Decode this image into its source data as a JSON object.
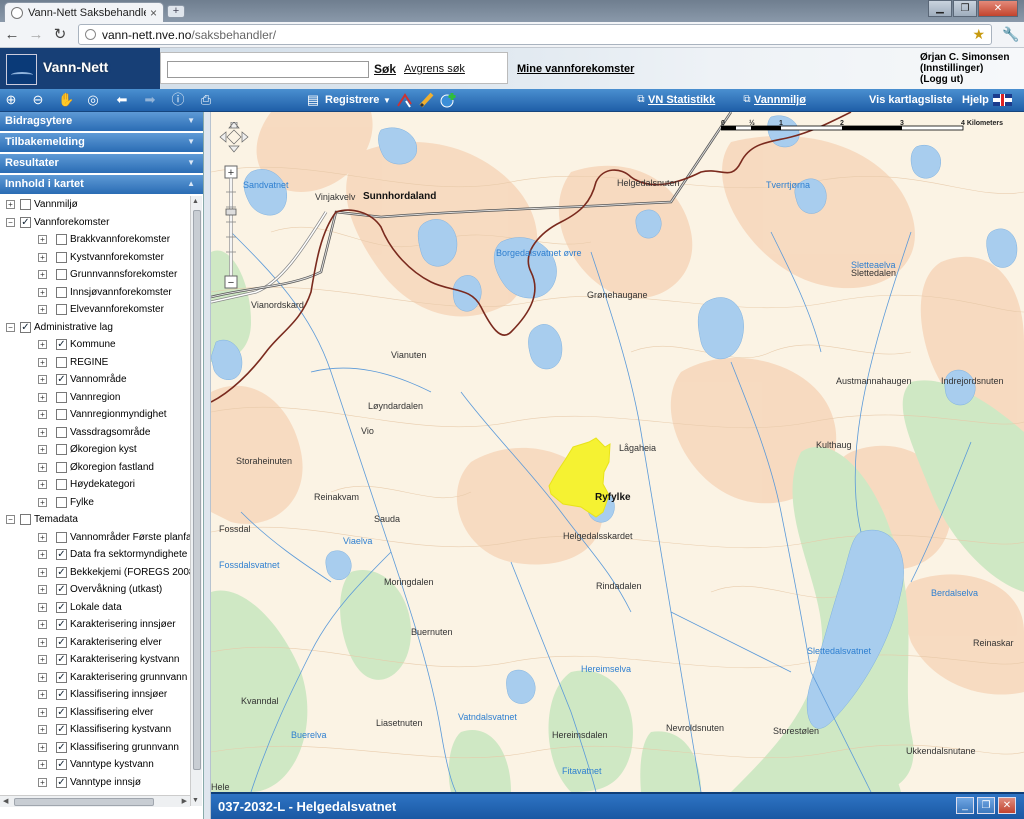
{
  "browser": {
    "tab_title": "Vann-Nett Saksbehandler",
    "tab_close": "×",
    "new_tab": "+",
    "url_host": "vann-nett.nve.no",
    "url_path": "/saksbehandler/",
    "window_buttons": [
      "▁",
      "❐",
      "✕"
    ]
  },
  "header": {
    "brand": "Vann-Nett",
    "search_value": "",
    "search_button": "Søk",
    "refine_link": "Avgrens søk",
    "mine_link": "Mine vannforekomster",
    "user_name": "Ørjan C. Simonsen",
    "settings_link": "(Innstillinger)",
    "logout_link": "(Logg ut)"
  },
  "toolbar": {
    "registrere": "Registrere",
    "vn_statistikk": "VN Statistikk",
    "vannmiljo": "Vannmiljø",
    "vis_kartlagsliste": "Vis kartlagsliste",
    "hjelp": "Hjelp"
  },
  "sidebar": {
    "panels": [
      "Bidragsytere",
      "Tilbakemelding",
      "Resultater",
      "Innhold i kartet"
    ],
    "tree": [
      {
        "label": "Vannmiljø",
        "level": 0,
        "checked": false
      },
      {
        "label": "Vannforekomster",
        "level": 0,
        "checked": true,
        "expanded": true
      },
      {
        "label": "Brakkvannforekomster",
        "level": 1,
        "checked": false
      },
      {
        "label": "Kystvannforekomster",
        "level": 1,
        "checked": false
      },
      {
        "label": "Grunnvannsforekomster",
        "level": 1,
        "checked": false
      },
      {
        "label": "Innsjøvannforekomster",
        "level": 1,
        "checked": false
      },
      {
        "label": "Elvevannforekomster",
        "level": 1,
        "checked": false
      },
      {
        "label": "Administrative lag",
        "level": 0,
        "checked": true,
        "expanded": true
      },
      {
        "label": "Kommune",
        "level": 1,
        "checked": true
      },
      {
        "label": "REGINE",
        "level": 1,
        "checked": false
      },
      {
        "label": "Vannområde",
        "level": 1,
        "checked": true
      },
      {
        "label": "Vannregion",
        "level": 1,
        "checked": false
      },
      {
        "label": "Vannregionmyndighet",
        "level": 1,
        "checked": false
      },
      {
        "label": "Vassdragsområde",
        "level": 1,
        "checked": false
      },
      {
        "label": "Økoregion kyst",
        "level": 1,
        "checked": false
      },
      {
        "label": "Økoregion fastland",
        "level": 1,
        "checked": false
      },
      {
        "label": "Høydekategori",
        "level": 1,
        "checked": false
      },
      {
        "label": "Fylke",
        "level": 1,
        "checked": false
      },
      {
        "label": "Temadata",
        "level": 0,
        "checked": false,
        "expanded": true
      },
      {
        "label": "Vannområder Første planfa",
        "level": 1,
        "checked": false
      },
      {
        "label": "Data fra sektormyndighete",
        "level": 1,
        "checked": true
      },
      {
        "label": "Bekkekjemi (FOREGS 2008",
        "level": 1,
        "checked": true
      },
      {
        "label": "Overvåkning (utkast)",
        "level": 1,
        "checked": true
      },
      {
        "label": "Lokale data",
        "level": 1,
        "checked": true
      },
      {
        "label": "Karakterisering innsjøer",
        "level": 1,
        "checked": true
      },
      {
        "label": "Karakterisering elver",
        "level": 1,
        "checked": true
      },
      {
        "label": "Karakterisering kystvann",
        "level": 1,
        "checked": true
      },
      {
        "label": "Karakterisering grunnvann",
        "level": 1,
        "checked": true
      },
      {
        "label": "Klassifisering innsjøer",
        "level": 1,
        "checked": true
      },
      {
        "label": "Klassifisering elver",
        "level": 1,
        "checked": true
      },
      {
        "label": "Klassifisering kystvann",
        "level": 1,
        "checked": true
      },
      {
        "label": "Klassifisering grunnvann",
        "level": 1,
        "checked": true
      },
      {
        "label": "Vanntype kystvann",
        "level": 1,
        "checked": true
      },
      {
        "label": "Vanntype innsjø",
        "level": 1,
        "checked": true
      }
    ]
  },
  "map": {
    "scale_ticks": [
      "0",
      "1",
      "2",
      "3",
      "4 Kilometers"
    ],
    "scale_sub": "½",
    "place_labels": [
      {
        "text": "Sunnhordaland",
        "style": "bold"
      },
      {
        "text": "Ryfylke",
        "style": "bold"
      },
      {
        "text": "Sandvatnet",
        "style": "blue"
      },
      {
        "text": "Vinjakvelv",
        "style": "normal"
      },
      {
        "text": "Helgedalsnuten",
        "style": "normal"
      },
      {
        "text": "Tverrtjørna",
        "style": "blue"
      },
      {
        "text": "Borgedalsvatnet øvre",
        "style": "blue"
      },
      {
        "text": "Sletteaelva",
        "style": "blue"
      },
      {
        "text": "Slettedalen",
        "style": "normal"
      },
      {
        "text": "Grønehaugane",
        "style": "normal"
      },
      {
        "text": "Vianordskard",
        "style": "normal"
      },
      {
        "text": "Vianuten",
        "style": "normal"
      },
      {
        "text": "Austmannahaugen",
        "style": "normal"
      },
      {
        "text": "Indrejordsnuten",
        "style": "normal"
      },
      {
        "text": "Løyndardalen",
        "style": "normal"
      },
      {
        "text": "Vio",
        "style": "normal"
      },
      {
        "text": "Kulthaug",
        "style": "normal"
      },
      {
        "text": "Lågaheia",
        "style": "normal"
      },
      {
        "text": "Storaheinuten",
        "style": "normal"
      },
      {
        "text": "Reinakvam",
        "style": "normal"
      },
      {
        "text": "Sauda",
        "style": "normal"
      },
      {
        "text": "Helgedalsskardet",
        "style": "normal"
      },
      {
        "text": "Fossdal",
        "style": "normal"
      },
      {
        "text": "Viaelva",
        "style": "blue"
      },
      {
        "text": "Fossdalsvatnet",
        "style": "blue"
      },
      {
        "text": "Moringdalen",
        "style": "normal"
      },
      {
        "text": "Rindadalen",
        "style": "normal"
      },
      {
        "text": "Berdalselva",
        "style": "blue"
      },
      {
        "text": "Buernuten",
        "style": "normal"
      },
      {
        "text": "Reinaskar",
        "style": "normal"
      },
      {
        "text": "Slettedalsvatnet",
        "style": "blue"
      },
      {
        "text": "Hereimselva",
        "style": "blue"
      },
      {
        "text": "Kvanndal",
        "style": "normal"
      },
      {
        "text": "Liasetnuten",
        "style": "normal"
      },
      {
        "text": "Vatndalsvatnet",
        "style": "blue"
      },
      {
        "text": "Buerelva",
        "style": "blue"
      },
      {
        "text": "Hereimsdalen",
        "style": "normal"
      },
      {
        "text": "Storestølen",
        "style": "normal"
      },
      {
        "text": "Nevroldsnuten",
        "style": "normal"
      },
      {
        "text": "Ukkendalsnutane",
        "style": "normal"
      },
      {
        "text": "Fitavatnet",
        "style": "blue"
      },
      {
        "text": "Hele",
        "style": "normal"
      }
    ]
  },
  "bottom_panel": {
    "title": "037-2032-L - Helgedalsvatnet"
  },
  "colors": {
    "toolbar": "#2a6cb4",
    "selection": "#f5f232",
    "water": "#a8cdee",
    "forest": "#cfe8c4",
    "mountain": "#f7d9bf"
  }
}
